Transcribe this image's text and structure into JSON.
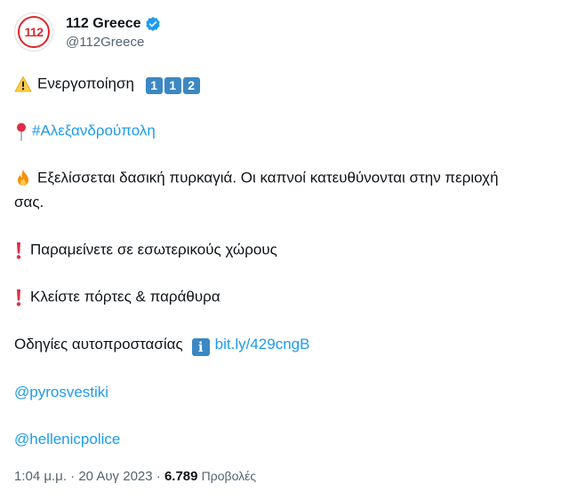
{
  "account": {
    "display_name": "112 Greece",
    "handle": "@112Greece",
    "avatar_text": "112",
    "verified": true
  },
  "tweet": {
    "line1_text": "Ενεργοποίηση",
    "keycaps": [
      "1",
      "1",
      "2"
    ],
    "hashtag": "#Αλεξανδρούπολη",
    "fire_line_a": "Εξελίσσεται δασική πυρκαγιά. Οι καπνοί κατευθύνονται στην περιοχή",
    "fire_line_b": "σας.",
    "stay_indoors": "Παραμείνετε σε εσωτερικούς χώρους",
    "close_doors": "Κλείστε πόρτες & παράθυρα",
    "guidance_text": "Οδηγίες αυτοπροστασίας",
    "info_symbol": "i",
    "guidance_link": "bit.ly/429cngB",
    "mention1": "@pyrosvestiki",
    "mention2": "@hellenicpolice"
  },
  "meta": {
    "time": "1:04 μ.μ.",
    "sep1": " · ",
    "date": "20 Αυγ 2023",
    "sep2": " · ",
    "view_count": "6.789",
    "views_label": "Προβολές"
  },
  "colors": {
    "link": "#1d9bf0",
    "secondary_text": "#536471",
    "brand_red": "#e0262b",
    "keycap_blue": "#3b88c3"
  },
  "icons": [
    "warning-icon",
    "round-pushpin-icon",
    "fire-icon",
    "exclamation-icon",
    "information-icon",
    "verified-badge-icon"
  ]
}
